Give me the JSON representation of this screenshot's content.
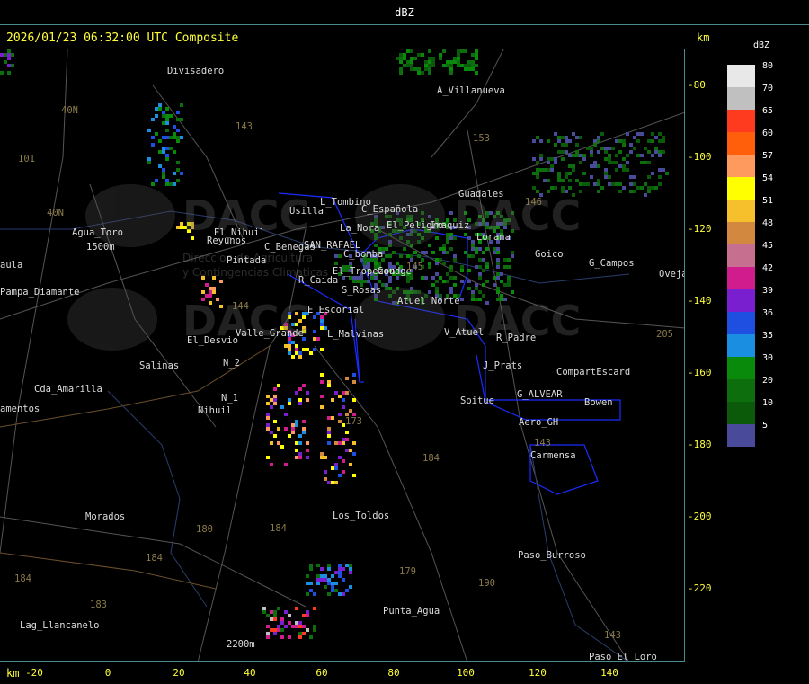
{
  "header": {
    "title": "dBZ"
  },
  "map": {
    "timestamp": "2026/01/23 06:32:00 UTC Composite",
    "km_unit": "km",
    "x_ticks": [
      "-20",
      "0",
      "20",
      "40",
      "60",
      "80",
      "100",
      "120",
      "140"
    ],
    "y_ticks": [
      "-80",
      "-100",
      "-120",
      "-140",
      "-160",
      "-180",
      "-200",
      "-220"
    ],
    "places": [
      "Divisadero",
      "A_Villanueva",
      "Guadales",
      "L_Tombino",
      "Usilla",
      "C_Española",
      "La_Nora",
      "El_Peligro",
      "Iraquiz",
      "C_Benegas",
      "SAN_RAFAEL",
      "C_bomba",
      "Lorana",
      "Goico",
      "G_Campos",
      "Oveja",
      "Agua_Toro",
      "1500m",
      "Reyunos",
      "Pintada",
      "El_Nihuil",
      "Pampa_Diamante",
      "R_Caida",
      "S_Rosas",
      "El_Tropezon",
      "Goudge",
      "Atuel_Norte",
      "E_Escorial",
      "Valle_Grande",
      "L_Malvinas",
      "V_Atuel",
      "R_Padre",
      "El_Desvio",
      "Salinas",
      "N_2",
      "N_1",
      "Nihuil",
      "J_Prats",
      "CompartEscard",
      "G_ALVEAR",
      "Bowen",
      "Soitue",
      "Aero_GH",
      "Carmensa",
      "Cda_Amarilla",
      "Morados",
      "Los_Toldos",
      "Paso_Burroso",
      "Punta_Agua",
      "Lag_Llancanelo",
      "2200m",
      "Paso_El_Loro",
      "amentos",
      "aula"
    ],
    "roads": [
      "40N",
      "101",
      "143",
      "153",
      "146",
      "40N",
      "144",
      "145",
      "143",
      "173",
      "184",
      "180",
      "184",
      "184",
      "184",
      "183",
      "179",
      "190",
      "143",
      "205"
    ],
    "watermark": {
      "brand": "DACC",
      "line1": "Direccion de Agricultura",
      "line2": "y Contingencias Climaticas"
    }
  },
  "legend": {
    "title": "dBZ",
    "levels": [
      {
        "label": "80",
        "color": "#e8e8e8"
      },
      {
        "label": "70",
        "color": "#c0c0c0"
      },
      {
        "label": "65",
        "color": "#ff3b1f"
      },
      {
        "label": "60",
        "color": "#ff5f0a"
      },
      {
        "label": "57",
        "color": "#ff9a5e"
      },
      {
        "label": "54",
        "color": "#ffff00"
      },
      {
        "label": "51",
        "color": "#f6c02c"
      },
      {
        "label": "48",
        "color": "#d2883e"
      },
      {
        "label": "45",
        "color": "#c76f8e"
      },
      {
        "label": "42",
        "color": "#d01c8c"
      },
      {
        "label": "39",
        "color": "#7a1fd0"
      },
      {
        "label": "36",
        "color": "#1f4fe0"
      },
      {
        "label": "35",
        "color": "#1a8ee0"
      },
      {
        "label": "30",
        "color": "#0a8a0a"
      },
      {
        "label": "20",
        "color": "#0c6e0c"
      },
      {
        "label": "10",
        "color": "#0a5a0a"
      },
      {
        "label": "5",
        "color": "#4a4a9a"
      }
    ]
  }
}
